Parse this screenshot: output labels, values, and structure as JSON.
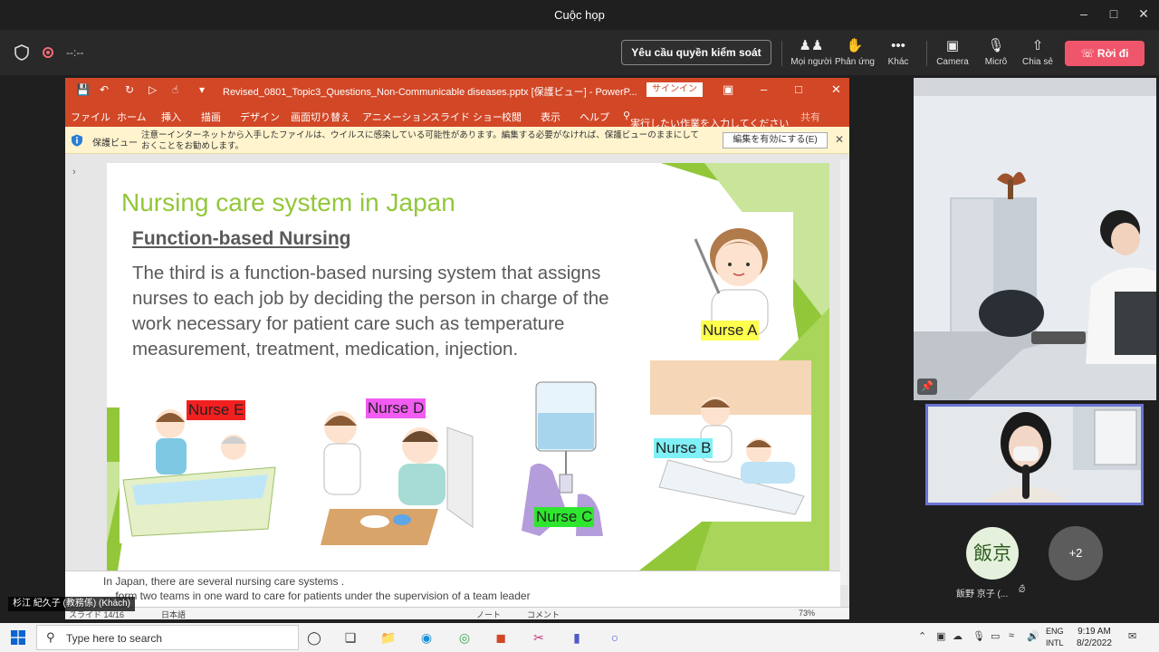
{
  "window": {
    "title": "Cuộc họp"
  },
  "toolbar": {
    "timer": "--:--",
    "request_control": "Yêu cầu quyền kiểm soát",
    "people": "Mọi người",
    "reactions": "Phản ứng",
    "more": "Khác",
    "camera": "Camera",
    "mic": "Micrô",
    "share": "Chia sẻ",
    "leave": "Rời đi"
  },
  "ppt": {
    "filename": "Revised_0801_Topic3_Questions_Non-Communicable diseases.pptx [保護ビュー] - PowerP...",
    "signin": "サインイン",
    "tabs": [
      "ファイル",
      "ホーム",
      "挿入",
      "描画",
      "デザイン",
      "画面切り替え",
      "アニメーション",
      "スライド ショー",
      "校閲",
      "表示",
      "ヘルプ",
      "実行したい作業を入力してください",
      "共有"
    ],
    "protected_view": {
      "label": "保護ビュー",
      "message": "注意ーインターネットから入手したファイルは、ウイルスに感染している可能性があります。編集する必要がなければ、保護ビューのままにしておくことをお勧めします。",
      "enable_button": "編集を有効にする(E)"
    },
    "slide": {
      "title": "Nursing care system in Japan",
      "subtitle": "Function-based Nursing",
      "body": "The third is a function-based nursing system that assigns nurses to each job by deciding the person in charge of the work necessary for patient care such as temperature measurement, treatment, medication, injection.",
      "labels": {
        "a": "Nurse A",
        "b": "Nurse B",
        "c": "Nurse C",
        "d": "Nurse D",
        "e": "Nurse E"
      },
      "label_colors": {
        "a": "#ffff4d",
        "b": "#7ff0f6",
        "c": "#2ee62e",
        "d": "#f25cf2",
        "e": "#f22020"
      }
    },
    "notes": {
      "line1": "In Japan, there are several nursing care systems .",
      "line2": "... form two teams in one ward to care for patients under the supervision of a team leader"
    },
    "status": {
      "slide_num": "スライド 14/16",
      "lang": "日本語",
      "notes_btn": "ノート",
      "comments_btn": "コメント",
      "zoom": "73%"
    }
  },
  "participants": {
    "presenter": "杉江 紀久子 (教務係) (Khách)",
    "avatar_initials": "飯京",
    "avatar_name": "飯野 京子 (...",
    "more_count": "+2"
  },
  "taskbar": {
    "search_placeholder": "Type here to search",
    "lang_top": "ENG",
    "lang_bottom": "INTL",
    "time": "9:19 AM",
    "date": "8/2/2022"
  }
}
